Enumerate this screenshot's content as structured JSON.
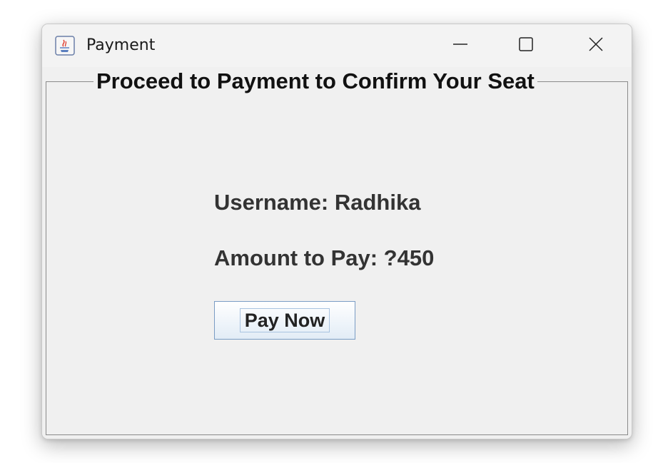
{
  "window": {
    "title": "Payment",
    "icon": "java-coffee-cup-icon"
  },
  "controls": {
    "minimize_icon": "minimize-icon",
    "maximize_icon": "maximize-icon",
    "close_icon": "close-icon"
  },
  "panel": {
    "border_title": "Proceed to Payment to Confirm Your Seat"
  },
  "details": {
    "username_label": "Username: Radhika",
    "amount_label": "Amount to Pay: ?450"
  },
  "actions": {
    "pay_label": "Pay Now"
  },
  "colors": {
    "window_bg": "#f0f0f0",
    "button_border": "#7a9cc4"
  }
}
